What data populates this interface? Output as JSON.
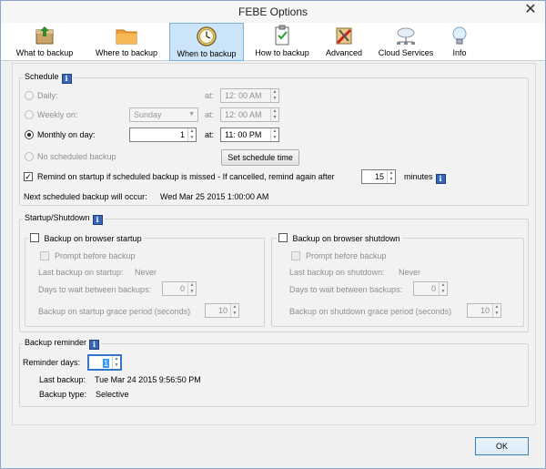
{
  "window": {
    "title": "FEBE Options",
    "close_glyph": "✕"
  },
  "toolbar": {
    "items": [
      {
        "label": "What to backup",
        "icon": "backup-box-icon"
      },
      {
        "label": "Where to backup",
        "icon": "folder-icon"
      },
      {
        "label": "When to backup",
        "icon": "clock-icon",
        "active": true
      },
      {
        "label": "How to backup",
        "icon": "clipboard-check-icon"
      },
      {
        "label": "Advanced",
        "icon": "tools-icon"
      },
      {
        "label": "Cloud Services",
        "icon": "cloud-network-icon"
      },
      {
        "label": "Info",
        "icon": "lightbulb-icon"
      }
    ]
  },
  "schedule": {
    "title": "Schedule",
    "daily": {
      "label": "Daily:",
      "at": "at:",
      "time": "12: 00 AM"
    },
    "weekly": {
      "label": "Weekly on:",
      "day": "Sunday",
      "at": "at:",
      "time": "12: 00 AM"
    },
    "monthly": {
      "label": "Monthly on day:",
      "day": "1",
      "at": "at:",
      "time": "11: 00 PM"
    },
    "none": {
      "label": "No scheduled backup"
    },
    "set_schedule_button": "Set schedule time",
    "remind": {
      "label": "Remind on startup if scheduled backup is missed - If cancelled, remind again after",
      "value": "15",
      "unit": "minutes"
    },
    "next": {
      "label": "Next scheduled backup will occur:",
      "value": "Wed Mar 25 2015 1:00:00 AM"
    }
  },
  "startup_shutdown": {
    "title": "Startup/Shutdown",
    "startup": {
      "label": "Backup on browser startup",
      "prompt": "Prompt before backup",
      "last_label": "Last backup on startup:",
      "last_value": "Never",
      "days_label": "Days to wait between backups:",
      "days_value": "0",
      "grace_label": "Backup on startup grace period (seconds)",
      "grace_value": "10"
    },
    "shutdown": {
      "label": "Backup on browser shutdown",
      "prompt": "Prompt before backup",
      "last_label": "Last backup on shutdown:",
      "last_value": "Never",
      "days_label": "Days to wait between backups:",
      "days_value": "0",
      "grace_label": "Backup on shutdown grace period (seconds)",
      "grace_value": "10"
    }
  },
  "reminder": {
    "title": "Backup reminder",
    "days_label": "Reminder days:",
    "days_value": "1",
    "last_label": "Last backup:",
    "last_value": "Tue Mar 24 2015 9:56:50 PM",
    "type_label": "Backup type:",
    "type_value": "Selective"
  },
  "footer": {
    "ok_label": "OK"
  },
  "colors": {
    "active_tab": "#cce4f7",
    "info_badge": "#3867b8"
  }
}
